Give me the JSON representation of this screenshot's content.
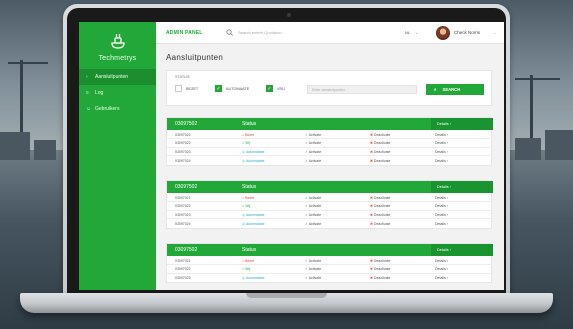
{
  "app": {
    "logo_text": "Techmetrys",
    "admin_title": "ADMIN PANEL"
  },
  "header": {
    "search_placeholder": "Search enterh Qooidooo...",
    "language": "NL",
    "user_name": "Check Norris"
  },
  "sidebar": {
    "items": [
      {
        "label": "Aansluitpunten",
        "icon": "chevron-right-icon",
        "active": true
      },
      {
        "label": "Log",
        "icon": "list-icon",
        "active": false
      },
      {
        "label": "Gebruikers",
        "icon": "users-icon",
        "active": false
      }
    ]
  },
  "page": {
    "title": "Aansluitpunten"
  },
  "filter": {
    "label": "STATUS:",
    "options": [
      {
        "label": "BEZET",
        "checked": false
      },
      {
        "label": "AUTOMAATE",
        "checked": true
      },
      {
        "label": "VRIJ",
        "checked": true
      }
    ],
    "input_placeholder": "Enter aansluitpunten...",
    "button_label": "SEARCH"
  },
  "tables": [
    {
      "header": {
        "id": "03097502",
        "status": "Status",
        "details": "Details"
      },
      "rows": [
        {
          "id": "03097022",
          "status": "Bezet",
          "status_kind": "red",
          "activate": "Activate",
          "deactivate": "Deactivate",
          "details": "Details"
        },
        {
          "id": "03097022",
          "status": "Vrij",
          "status_kind": "green",
          "activate": "Activate",
          "deactivate": "Deactivate",
          "details": "Details"
        },
        {
          "id": "03097023",
          "status": "Automatiate",
          "status_kind": "blue",
          "activate": "Activate",
          "deactivate": "Deactivate",
          "details": "Details"
        },
        {
          "id": "03097024",
          "status": "Automatiate",
          "status_kind": "blue",
          "activate": "Activate",
          "deactivate": "Deactivate",
          "details": "Details"
        }
      ]
    },
    {
      "header": {
        "id": "03097502",
        "status": "Status",
        "details": "Details"
      },
      "rows": [
        {
          "id": "03097021",
          "status": "Bezet",
          "status_kind": "red",
          "activate": "Activate",
          "deactivate": "Deactivate",
          "details": "Details"
        },
        {
          "id": "03097022",
          "status": "Vrij",
          "status_kind": "green",
          "activate": "Activate",
          "deactivate": "Deactivate",
          "details": "Details"
        },
        {
          "id": "03097023",
          "status": "Automatiate",
          "status_kind": "blue",
          "activate": "Activate",
          "deactivate": "Deactivate",
          "details": "Details"
        },
        {
          "id": "03097024",
          "status": "Automatiate",
          "status_kind": "blue",
          "activate": "Activate",
          "deactivate": "Deactivate",
          "details": "Details"
        }
      ]
    },
    {
      "header": {
        "id": "03097502",
        "status": "Status",
        "details": "Details"
      },
      "rows": [
        {
          "id": "03097021",
          "status": "Bezet",
          "status_kind": "red",
          "activate": "Activate",
          "deactivate": "Deactivate",
          "details": "Details"
        },
        {
          "id": "03097022",
          "status": "Vrij",
          "status_kind": "green",
          "activate": "Activate",
          "deactivate": "Deactivate",
          "details": "Details"
        },
        {
          "id": "03097023",
          "status": "Automatiate",
          "status_kind": "blue",
          "activate": "Activate",
          "deactivate": "Deactivate",
          "details": "Details"
        }
      ]
    }
  ],
  "colors": {
    "brand_green": "#22a839",
    "brand_green_dark": "#1b8f2e",
    "status_red": "#e04a3b",
    "status_blue": "#35a7c9"
  }
}
